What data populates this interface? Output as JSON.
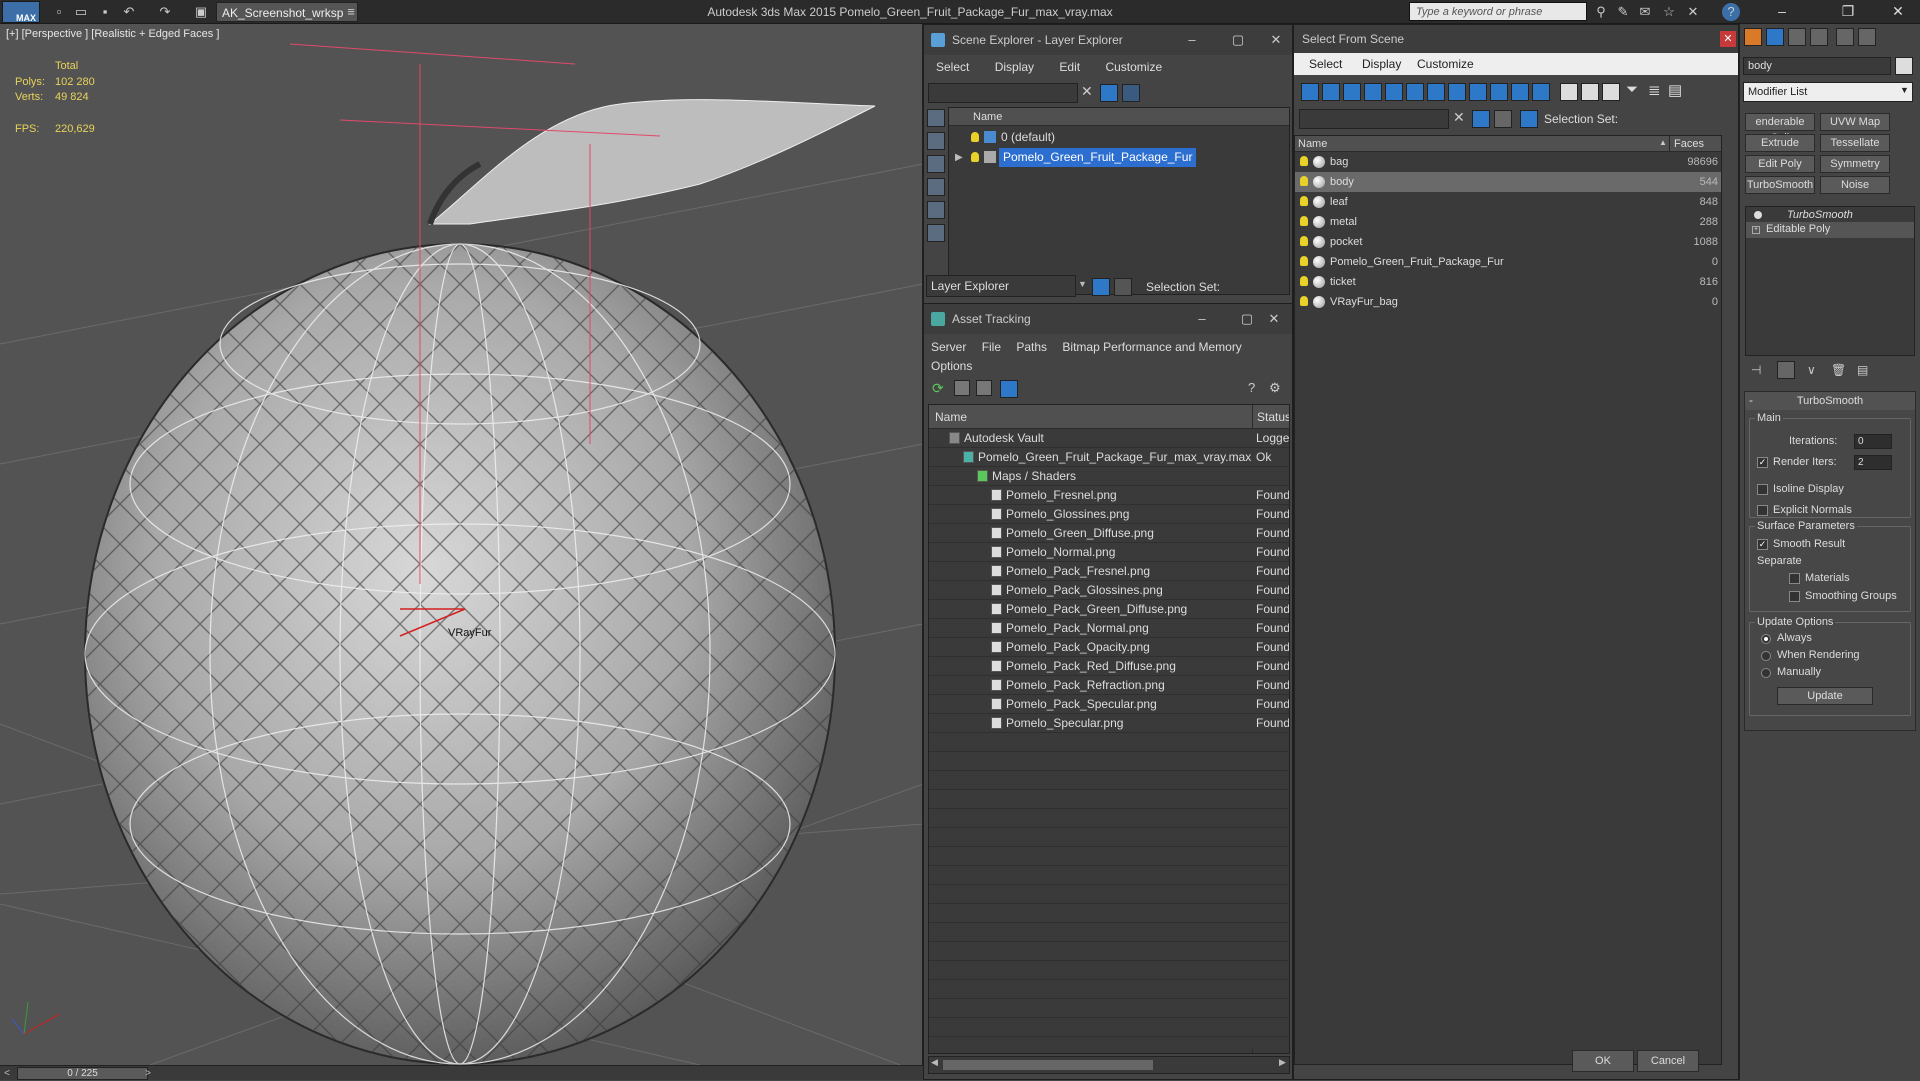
{
  "titlebar": {
    "workspace": "AK_Screenshot_wrksp",
    "app_title": "Autodesk 3ds Max  2015     Pomelo_Green_Fruit_Package_Fur_max_vray.max",
    "search_placeholder": "Type a keyword or phrase"
  },
  "viewport": {
    "label": "[+] [Perspective ] [Realistic + Edged Faces ]",
    "stats_total": "Total",
    "polys_label": "Polys:",
    "polys_value": "102 280",
    "verts_label": "Verts:",
    "verts_value": "49 824",
    "fps_label": "FPS:",
    "fps_value": "220,629",
    "object_label": "VRayFur"
  },
  "timeline": {
    "prev": "<",
    "frame": "0 / 225",
    "next": ">"
  },
  "scene_explorer": {
    "title": "Scene Explorer - Layer Explorer",
    "menu": [
      "Select",
      "Display",
      "Edit",
      "Customize"
    ],
    "column_name": "Name",
    "layers": [
      {
        "name": "0 (default)",
        "selected": false
      },
      {
        "name": "Pomelo_Green_Fruit_Package_Fur",
        "selected": true
      }
    ],
    "footer_dropdown": "Layer Explorer",
    "selection_set_label": "Selection Set:"
  },
  "asset_tracking": {
    "title": "Asset Tracking",
    "menu": [
      "Server",
      "File",
      "Paths",
      "Bitmap Performance and Memory"
    ],
    "menu2": "Options",
    "col_name": "Name",
    "col_status": "Status",
    "rows": [
      {
        "name": "Autodesk Vault",
        "status": "Logged",
        "indent": 0
      },
      {
        "name": "Pomelo_Green_Fruit_Package_Fur_max_vray.max",
        "status": "Ok",
        "indent": 1
      },
      {
        "name": "Maps / Shaders",
        "status": "",
        "indent": 2
      },
      {
        "name": "Pomelo_Fresnel.png",
        "status": "Found",
        "indent": 3
      },
      {
        "name": "Pomelo_Glossines.png",
        "status": "Found",
        "indent": 3
      },
      {
        "name": "Pomelo_Green_Diffuse.png",
        "status": "Found",
        "indent": 3
      },
      {
        "name": "Pomelo_Normal.png",
        "status": "Found",
        "indent": 3
      },
      {
        "name": "Pomelo_Pack_Fresnel.png",
        "status": "Found",
        "indent": 3
      },
      {
        "name": "Pomelo_Pack_Glossines.png",
        "status": "Found",
        "indent": 3
      },
      {
        "name": "Pomelo_Pack_Green_Diffuse.png",
        "status": "Found",
        "indent": 3
      },
      {
        "name": "Pomelo_Pack_Normal.png",
        "status": "Found",
        "indent": 3
      },
      {
        "name": "Pomelo_Pack_Opacity.png",
        "status": "Found",
        "indent": 3
      },
      {
        "name": "Pomelo_Pack_Red_Diffuse.png",
        "status": "Found",
        "indent": 3
      },
      {
        "name": "Pomelo_Pack_Refraction.png",
        "status": "Found",
        "indent": 3
      },
      {
        "name": "Pomelo_Pack_Specular.png",
        "status": "Found",
        "indent": 3
      },
      {
        "name": "Pomelo_Specular.png",
        "status": "Found",
        "indent": 3
      }
    ]
  },
  "select_from_scene": {
    "title": "Select From Scene",
    "menu": [
      "Select",
      "Display",
      "Customize"
    ],
    "selection_set_label": "Selection Set:",
    "col_name": "Name",
    "col_faces": "Faces",
    "objects": [
      {
        "name": "bag",
        "faces": "98696",
        "selected": false
      },
      {
        "name": "body",
        "faces": "544",
        "selected": true
      },
      {
        "name": "leaf",
        "faces": "848",
        "selected": false
      },
      {
        "name": "metal",
        "faces": "288",
        "selected": false
      },
      {
        "name": "pocket",
        "faces": "1088",
        "selected": false
      },
      {
        "name": "Pomelo_Green_Fruit_Package_Fur",
        "faces": "0",
        "selected": false
      },
      {
        "name": "ticket",
        "faces": "816",
        "selected": false
      },
      {
        "name": "VRayFur_bag",
        "faces": "0",
        "selected": false
      }
    ],
    "ok": "OK",
    "cancel": "Cancel"
  },
  "command_panel": {
    "object_name": "body",
    "modifier_list": "Modifier List",
    "buttons": [
      "enderable Spli",
      "UVW Map",
      "Extrude",
      "Tessellate",
      "Edit Poly",
      "Symmetry",
      "TurboSmooth",
      "Noise"
    ],
    "stack": [
      "TurboSmooth",
      "Editable Poly"
    ],
    "rollout_title": "TurboSmooth",
    "main_label": "Main",
    "iterations_label": "Iterations:",
    "iterations_value": "0",
    "render_iters_label": "Render Iters:",
    "render_iters_value": "2",
    "isoline_display": "Isoline Display",
    "explicit_normals": "Explicit Normals",
    "surface_parameters": "Surface Parameters",
    "smooth_result": "Smooth Result",
    "separate": "Separate",
    "materials": "Materials",
    "smoothing_groups": "Smoothing Groups",
    "update_options": "Update Options",
    "always": "Always",
    "when_rendering": "When Rendering",
    "manually": "Manually",
    "update_button": "Update"
  }
}
